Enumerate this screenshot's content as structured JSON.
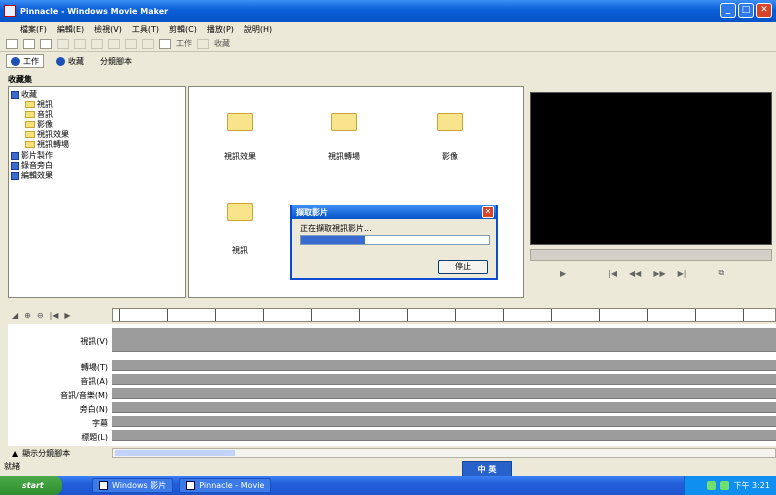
{
  "window": {
    "title": "Pinnacle - Windows Movie Maker"
  },
  "menu": [
    "檔案(F)",
    "編輯(E)",
    "檢視(V)",
    "工具(T)",
    "剪輯(C)",
    "播放(P)",
    "說明(H)"
  ],
  "toolbar": {
    "tasks_label": "工作",
    "collections_label": "收藏"
  },
  "tabs": {
    "tasks": "工作",
    "collections": "收藏",
    "storyboard": "分鏡腳本"
  },
  "tree": {
    "header": "收藏集",
    "root": "收藏",
    "folders": [
      "視訊",
      "音訊",
      "影像",
      "視訊效果",
      "視訊轉場"
    ],
    "extras": [
      "影片製作",
      "錄音旁白",
      "編輯效果"
    ]
  },
  "assets": {
    "folders": [
      "視訊效果",
      "視訊轉場",
      "影像",
      "視訊"
    ]
  },
  "preview": {
    "controls": [
      "播放",
      "上一個",
      "倒帶",
      "快轉",
      "下一個",
      "分割"
    ]
  },
  "dialog": {
    "title": "擷取影片",
    "message": "正在擷取視訊影片...",
    "progress": 0.34,
    "button": "停止"
  },
  "timeline": {
    "tracks": [
      "視訊(V)",
      "轉場(T)",
      "音訊(A)",
      "音訊/音樂(M)",
      "旁白(N)",
      "字幕",
      "標題(L)"
    ],
    "view_label": "顯示分鏡腳本"
  },
  "status": "就緒",
  "ime": "中 英",
  "taskbar": {
    "start": "start",
    "tasks": [
      "Windows 影片",
      "Pinnacle - Movie"
    ],
    "clock": "下午 3:21"
  }
}
